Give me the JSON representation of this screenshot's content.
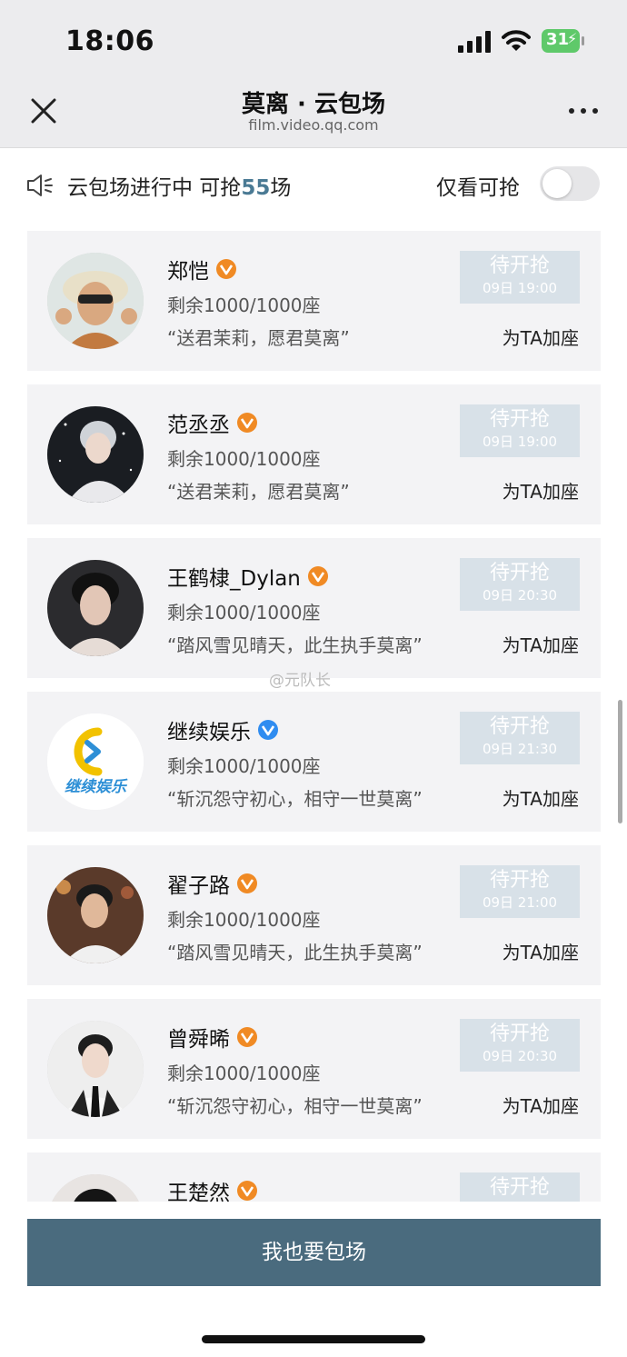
{
  "status_bar": {
    "time": "18:06",
    "battery": "31"
  },
  "nav": {
    "title": "莫离 · 云包场",
    "subtitle": "film.video.qq.com"
  },
  "notice": {
    "prefix": "云包场进行中 可抢",
    "count": "55",
    "suffix": "场"
  },
  "filter": {
    "label": "仅看可抢",
    "on": false
  },
  "cards": [
    {
      "name": "郑恺",
      "verified": "orange",
      "seats": "剩余1000/1000座",
      "slogan": "“送君茉莉，愿君莫离”",
      "status": "待开抢",
      "time": "09日 19:00",
      "action": "为TA加座"
    },
    {
      "name": "范丞丞",
      "verified": "orange",
      "seats": "剩余1000/1000座",
      "slogan": "“送君茉莉，愿君莫离”",
      "status": "待开抢",
      "time": "09日 19:00",
      "action": "为TA加座"
    },
    {
      "name": "王鹤棣_Dylan",
      "verified": "orange",
      "seats": "剩余1000/1000座",
      "slogan": "“踏风雪见晴天，此生执手莫离”",
      "status": "待开抢",
      "time": "09日 20:30",
      "action": "为TA加座"
    },
    {
      "name": "继续娱乐",
      "verified": "blue",
      "seats": "剩余1000/1000座",
      "slogan": "“斩沉怨守初心，相守一世莫离”",
      "status": "待开抢",
      "time": "09日 21:30",
      "action": "为TA加座"
    },
    {
      "name": "翟子路",
      "verified": "orange",
      "seats": "剩余1000/1000座",
      "slogan": "“踏风雪见晴天，此生执手莫离”",
      "status": "待开抢",
      "time": "09日 21:00",
      "action": "为TA加座"
    },
    {
      "name": "曾舜晞",
      "verified": "orange",
      "seats": "剩余1000/1000座",
      "slogan": "“斩沉怨守初心，相守一世莫离”",
      "status": "待开抢",
      "time": "09日 20:30",
      "action": "为TA加座"
    },
    {
      "name": "王楚然",
      "verified": "orange",
      "seats": "",
      "slogan": "",
      "status": "待开抢",
      "time": "",
      "action": ""
    }
  ],
  "logo_text": "继续娱乐",
  "watermark": "@元队长",
  "cta": {
    "label": "我也要包场"
  },
  "colors": {
    "accent": "#4a6b7e",
    "count": "#4a7a94",
    "status_btn": "#d8e1e8",
    "badge_orange": "#f08a24",
    "badge_blue": "#2f8cf0"
  }
}
